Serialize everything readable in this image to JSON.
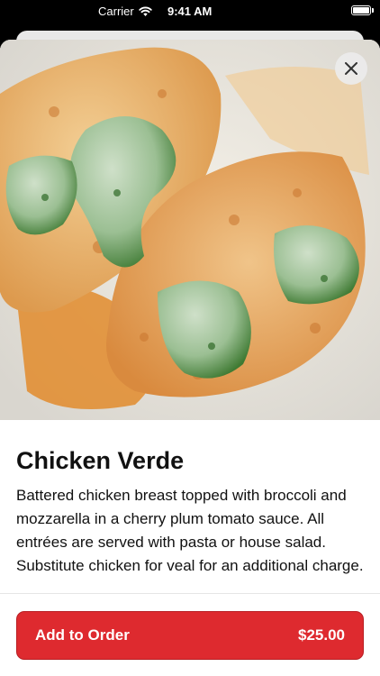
{
  "status_bar": {
    "carrier": "Carrier",
    "time": "9:41 AM",
    "icons": [
      "wifi-icon",
      "battery-icon"
    ]
  },
  "item": {
    "image_alt": "chicken-verde-photo",
    "title": "Chicken Verde",
    "description": "Battered chicken breast topped with broccoli and mozzarella in a cherry plum tomato sauce. All entrées are served with pasta or house salad. Substitute chicken for veal for an additional charge."
  },
  "order_button": {
    "label": "Add to Order",
    "price": "$25.00"
  },
  "colors": {
    "accent": "#de2a2f",
    "close_bg": "#ebebeb",
    "text": "#111111"
  }
}
